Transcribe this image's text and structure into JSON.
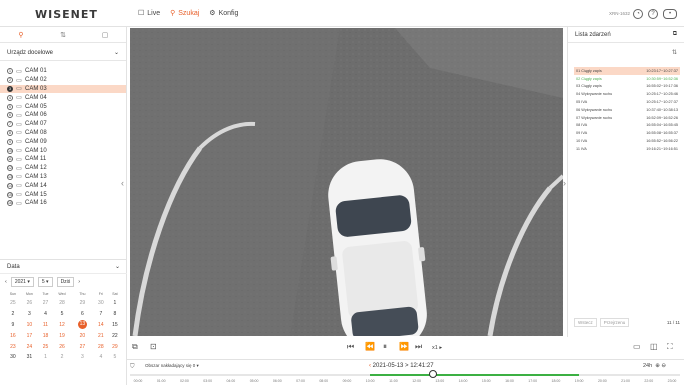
{
  "app": {
    "logo": "WISENET",
    "model": "XRN-1632"
  },
  "menu": [
    {
      "label": "Live",
      "icon": "monitor-icon",
      "glyph": "☐"
    },
    {
      "label": "Szukaj",
      "icon": "search-icon",
      "glyph": "⚲"
    },
    {
      "label": "Konfig",
      "icon": "gear-icon",
      "glyph": "⚙"
    }
  ],
  "left": {
    "device_dropdown": "Urządz docelowe",
    "cameras": [
      "CAM 01",
      "CAM 02",
      "CAM 03",
      "CAM 04",
      "CAM 05",
      "CAM 06",
      "CAM 07",
      "CAM 08",
      "CAM 09",
      "CAM 10",
      "CAM 11",
      "CAM 12",
      "CAM 13",
      "CAM 14",
      "CAM 15",
      "CAM 16"
    ],
    "selected_camera": "CAM 03",
    "date_label": "Data",
    "year": "2021",
    "month": "5",
    "today_button": "Dziś",
    "weekdays": [
      "Sun",
      "Mon",
      "Tue",
      "Wed",
      "Thu",
      "Fri",
      "Sat"
    ],
    "weeks": [
      [
        "25",
        "26",
        "27",
        "28",
        "29",
        "30",
        "1"
      ],
      [
        "2",
        "3",
        "4",
        "5",
        "6",
        "7",
        "8"
      ],
      [
        "9",
        "10",
        "11",
        "12",
        "13",
        "14",
        "15"
      ],
      [
        "16",
        "17",
        "18",
        "19",
        "20",
        "21",
        "22"
      ],
      [
        "23",
        "24",
        "25",
        "26",
        "27",
        "28",
        "29"
      ],
      [
        "30",
        "31",
        "1",
        "2",
        "3",
        "4",
        "5"
      ]
    ],
    "selected_day": "13"
  },
  "controls": {
    "speed": "x1 ▸"
  },
  "timeline": {
    "overlap_label": "Obszar nakładający się 0",
    "date_time": "2021-05-13 > 12:41:27",
    "zoom": "24h",
    "hours": [
      "00:00",
      "01:00",
      "02:00",
      "03:00",
      "04:00",
      "05:00",
      "06:00",
      "07:00",
      "08:00",
      "09:00",
      "10:00",
      "11:00",
      "12:00",
      "13:00",
      "14:00",
      "15:00",
      "16:00",
      "17:00",
      "18:00",
      "19:00",
      "20:00",
      "21:00",
      "22:00",
      "23:00"
    ],
    "record_start_hour": 10.0,
    "record_end_hour": 19.0,
    "cursor_hour": 12.69,
    "colors": {
      "record": "#3cb043",
      "accent": "#e8602a"
    }
  },
  "events": {
    "title": "Lista zdarzeń",
    "items": [
      {
        "name": "01 Ciągły zapis",
        "time": "10:23:17~10:27:37"
      },
      {
        "name": "02 Ciągły zapis",
        "time": "10:30:59~16:52:36"
      },
      {
        "name": "03 Ciągły zapis",
        "time": "16:55:02~19:17:36"
      },
      {
        "name": "04 Wykrywanie ruchu",
        "time": "10:25:17~10:25:46"
      },
      {
        "name": "05 IVA",
        "time": "10:25:17~10:27:37"
      },
      {
        "name": "06 Wykrywanie ruchu",
        "time": "10:37:40~10:38:13"
      },
      {
        "name": "07 Wykrywanie ruchu",
        "time": "16:52:09~16:52:26"
      },
      {
        "name": "08 IVA",
        "time": "16:55:04~16:55:45"
      },
      {
        "name": "09 IVA",
        "time": "16:55:08~16:55:37"
      },
      {
        "name": "10 IVA",
        "time": "16:55:52~16:56:22"
      },
      {
        "name": "11 IVA",
        "time": "19:16:21~19:16:51"
      }
    ],
    "selected_index": 0,
    "highlight_index": 1,
    "prev_button": "Wstecz",
    "next_button": "Przejrzenu",
    "count": "11 / 11"
  }
}
